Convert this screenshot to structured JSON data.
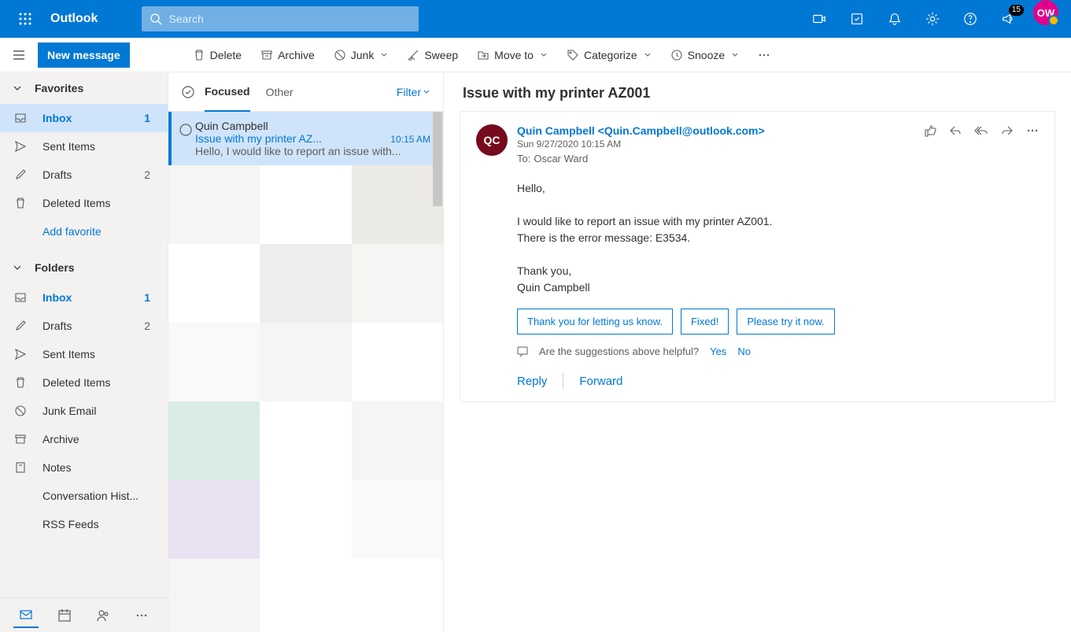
{
  "header": {
    "app_title": "Outlook",
    "search_placeholder": "Search",
    "notification_badge": "15",
    "avatar_initials": "OW"
  },
  "toolbar": {
    "new_message": "New message",
    "delete": "Delete",
    "archive": "Archive",
    "junk": "Junk",
    "sweep": "Sweep",
    "move_to": "Move to",
    "categorize": "Categorize",
    "snooze": "Snooze"
  },
  "nav": {
    "favorites_header": "Favorites",
    "folders_header": "Folders",
    "add_favorite": "Add favorite",
    "favorites": [
      {
        "label": "Inbox",
        "count": "1",
        "active": true
      },
      {
        "label": "Sent Items",
        "count": ""
      },
      {
        "label": "Drafts",
        "count": "2"
      },
      {
        "label": "Deleted Items",
        "count": ""
      }
    ],
    "folders": [
      {
        "label": "Inbox",
        "count": "1"
      },
      {
        "label": "Drafts",
        "count": "2"
      },
      {
        "label": "Sent Items",
        "count": ""
      },
      {
        "label": "Deleted Items",
        "count": ""
      },
      {
        "label": "Junk Email",
        "count": ""
      },
      {
        "label": "Archive",
        "count": ""
      },
      {
        "label": "Notes",
        "count": ""
      },
      {
        "label": "Conversation Hist...",
        "count": ""
      },
      {
        "label": "RSS Feeds",
        "count": ""
      }
    ]
  },
  "list": {
    "tabs": {
      "focused": "Focused",
      "other": "Other"
    },
    "filter": "Filter",
    "message": {
      "from": "Quin Campbell",
      "subject": "Issue with my printer AZ...",
      "time": "10:15 AM",
      "preview": "Hello, I would like to report an issue with..."
    }
  },
  "reading": {
    "subject": "Issue with my printer AZ001",
    "sender_initials": "QC",
    "sender_display": "Quin Campbell <Quin.Campbell@outlook.com>",
    "sent_date": "Sun 9/27/2020 10:15 AM",
    "to_label": "To:",
    "to_value": "Oscar Ward",
    "body": "Hello,\n\nI would like to report an issue with my printer AZ001.\nThere is the error message: E3534.\n\nThank you,\nQuin Campbell",
    "suggestions": [
      "Thank you for letting us know.",
      "Fixed!",
      "Please try it now."
    ],
    "feedback_prompt": "Are the suggestions above helpful?",
    "feedback_yes": "Yes",
    "feedback_no": "No",
    "reply": "Reply",
    "forward": "Forward"
  }
}
